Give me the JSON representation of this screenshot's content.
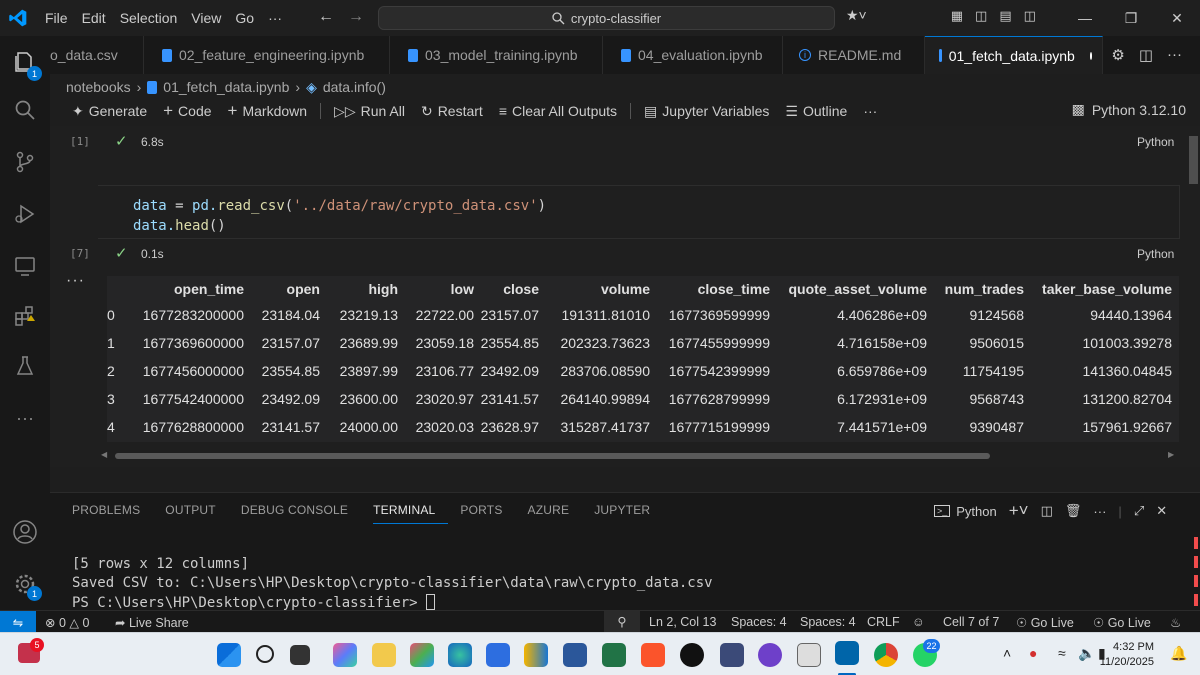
{
  "menu": [
    "File",
    "Edit",
    "Selection",
    "View",
    "Go",
    "···"
  ],
  "search": {
    "text": "crypto-classifier"
  },
  "tabs": [
    {
      "label": "o_data.csv",
      "kind": "csv"
    },
    {
      "label": "02_feature_engineering.ipynb",
      "kind": "notebook"
    },
    {
      "label": "03_model_training.ipynb",
      "kind": "notebook"
    },
    {
      "label": "04_evaluation.ipynb",
      "kind": "notebook"
    },
    {
      "label": "README.md",
      "kind": "info"
    },
    {
      "label": "01_fetch_data.ipynb",
      "kind": "notebook",
      "active": true,
      "modified": true
    }
  ],
  "breadcrumb": [
    "notebooks",
    "01_fetch_data.ipynb",
    "data.info()"
  ],
  "toolbar": {
    "generate": "Generate",
    "code": "Code",
    "markdown": "Markdown",
    "run_all": "Run All",
    "restart": "Restart",
    "clear_outputs": "Clear All Outputs",
    "variables": "Jupyter Variables",
    "outline": "Outline",
    "more": "···",
    "kernel": "Python 3.12.10"
  },
  "cells": {
    "first": {
      "exec_count": "[1]",
      "duration": "6.8s",
      "language": "Python"
    },
    "second": {
      "exec_count": "[7]",
      "duration": "0.1s",
      "language": "Python",
      "code_var": "data",
      "code_eq": " = ",
      "code_mod": "pd.",
      "code_fn": "read_csv",
      "code_open": "(",
      "code_str": "'../data/raw/crypto_data.csv'",
      "code_close": ")",
      "code2_var": "data.",
      "code2_fn": "head",
      "code2_rest": "()"
    }
  },
  "output_more": "···",
  "dataframe": {
    "columns": [
      "",
      "open_time",
      "open",
      "high",
      "low",
      "close",
      "volume",
      "close_time",
      "quote_asset_volume",
      "num_trades",
      "taker_base_volume"
    ],
    "rows": [
      [
        "0",
        "1677283200000",
        "23184.04",
        "23219.13",
        "22722.00",
        "23157.07",
        "191311.81010",
        "1677369599999",
        "4.406286e+09",
        "9124568",
        "94440.13964"
      ],
      [
        "1",
        "1677369600000",
        "23157.07",
        "23689.99",
        "23059.18",
        "23554.85",
        "202323.73623",
        "1677455999999",
        "4.716158e+09",
        "9506015",
        "101003.39278"
      ],
      [
        "2",
        "1677456000000",
        "23554.85",
        "23897.99",
        "23106.77",
        "23492.09",
        "283706.08590",
        "1677542399999",
        "6.659786e+09",
        "11754195",
        "141360.04845"
      ],
      [
        "3",
        "1677542400000",
        "23492.09",
        "23600.00",
        "23020.97",
        "23141.57",
        "264140.99894",
        "1677628799999",
        "6.172931e+09",
        "9568743",
        "131200.82704"
      ],
      [
        "4",
        "1677628800000",
        "23141.57",
        "24000.00",
        "23020.03",
        "23628.97",
        "315287.41737",
        "1677715199999",
        "7.441571e+09",
        "9390487",
        "157961.92667"
      ]
    ]
  },
  "panel": {
    "tabs": [
      "PROBLEMS",
      "OUTPUT",
      "DEBUG CONSOLE",
      "TERMINAL",
      "PORTS",
      "AZURE",
      "JUPYTER"
    ],
    "active_tab": "TERMINAL",
    "terminal_name": "Python",
    "lines": [
      "[5 rows x 12 columns]",
      "Saved CSV to: C:\\Users\\HP\\Desktop\\crypto-classifier\\data\\raw\\crypto_data.csv",
      "PS C:\\Users\\HP\\Desktop\\crypto-classifier> "
    ]
  },
  "activity_badges": {
    "explorer": "1",
    "settings": "1"
  },
  "statusbar": {
    "errors": "0",
    "warnings": "0",
    "live_share": "Live Share",
    "position": "Ln 2, Col 13",
    "spaces1": "Spaces: 4",
    "spaces2": "Spaces: 4",
    "eol": "CRLF",
    "cell": "Cell 7 of 7",
    "go_live1": "Go Live",
    "go_live2": "Go Live"
  },
  "taskbar": {
    "notification_badge": "5",
    "whatsapp_badge": "22",
    "time": "4:32 PM",
    "date": "11/20/2025"
  },
  "colors": {
    "accent": "#0078d4",
    "success": "#89d185",
    "string": "#ce9178",
    "function": "#dcdcaa",
    "variable": "#9cdcfe"
  }
}
